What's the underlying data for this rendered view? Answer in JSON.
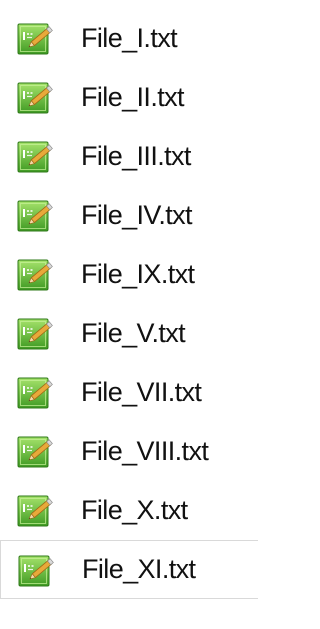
{
  "files": [
    {
      "name": "File_I.txt",
      "icon": "text-file-icon"
    },
    {
      "name": "File_II.txt",
      "icon": "text-file-icon"
    },
    {
      "name": "File_III.txt",
      "icon": "text-file-icon"
    },
    {
      "name": "File_IV.txt",
      "icon": "text-file-icon"
    },
    {
      "name": "File_IX.txt",
      "icon": "text-file-icon"
    },
    {
      "name": "File_V.txt",
      "icon": "text-file-icon"
    },
    {
      "name": "File_VII.txt",
      "icon": "text-file-icon"
    },
    {
      "name": "File_VIII.txt",
      "icon": "text-file-icon"
    },
    {
      "name": "File_X.txt",
      "icon": "text-file-icon"
    },
    {
      "name": "File_XI.txt",
      "icon": "text-file-icon"
    }
  ],
  "selected_index": 9,
  "colors": {
    "icon_green_light": "#a6e36b",
    "icon_green_dark": "#3f9a23",
    "icon_pencil": "#e8a93a",
    "selection_border": "#d9d9d9"
  }
}
